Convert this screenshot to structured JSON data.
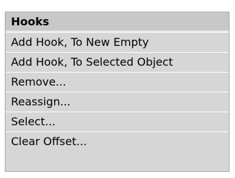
{
  "menu": {
    "title": "Hooks",
    "items": [
      {
        "label": "Add Hook, To New Empty"
      },
      {
        "label": "Add Hook, To Selected Object"
      },
      {
        "label": "Remove..."
      },
      {
        "label": "Reassign..."
      },
      {
        "label": "Select..."
      },
      {
        "label": "Clear Offset..."
      }
    ]
  },
  "colors": {
    "menu_background": "#d6d6d6",
    "title_background": "#c8c8c8",
    "separator": "#ffffff",
    "border": "#a8a8a8"
  }
}
